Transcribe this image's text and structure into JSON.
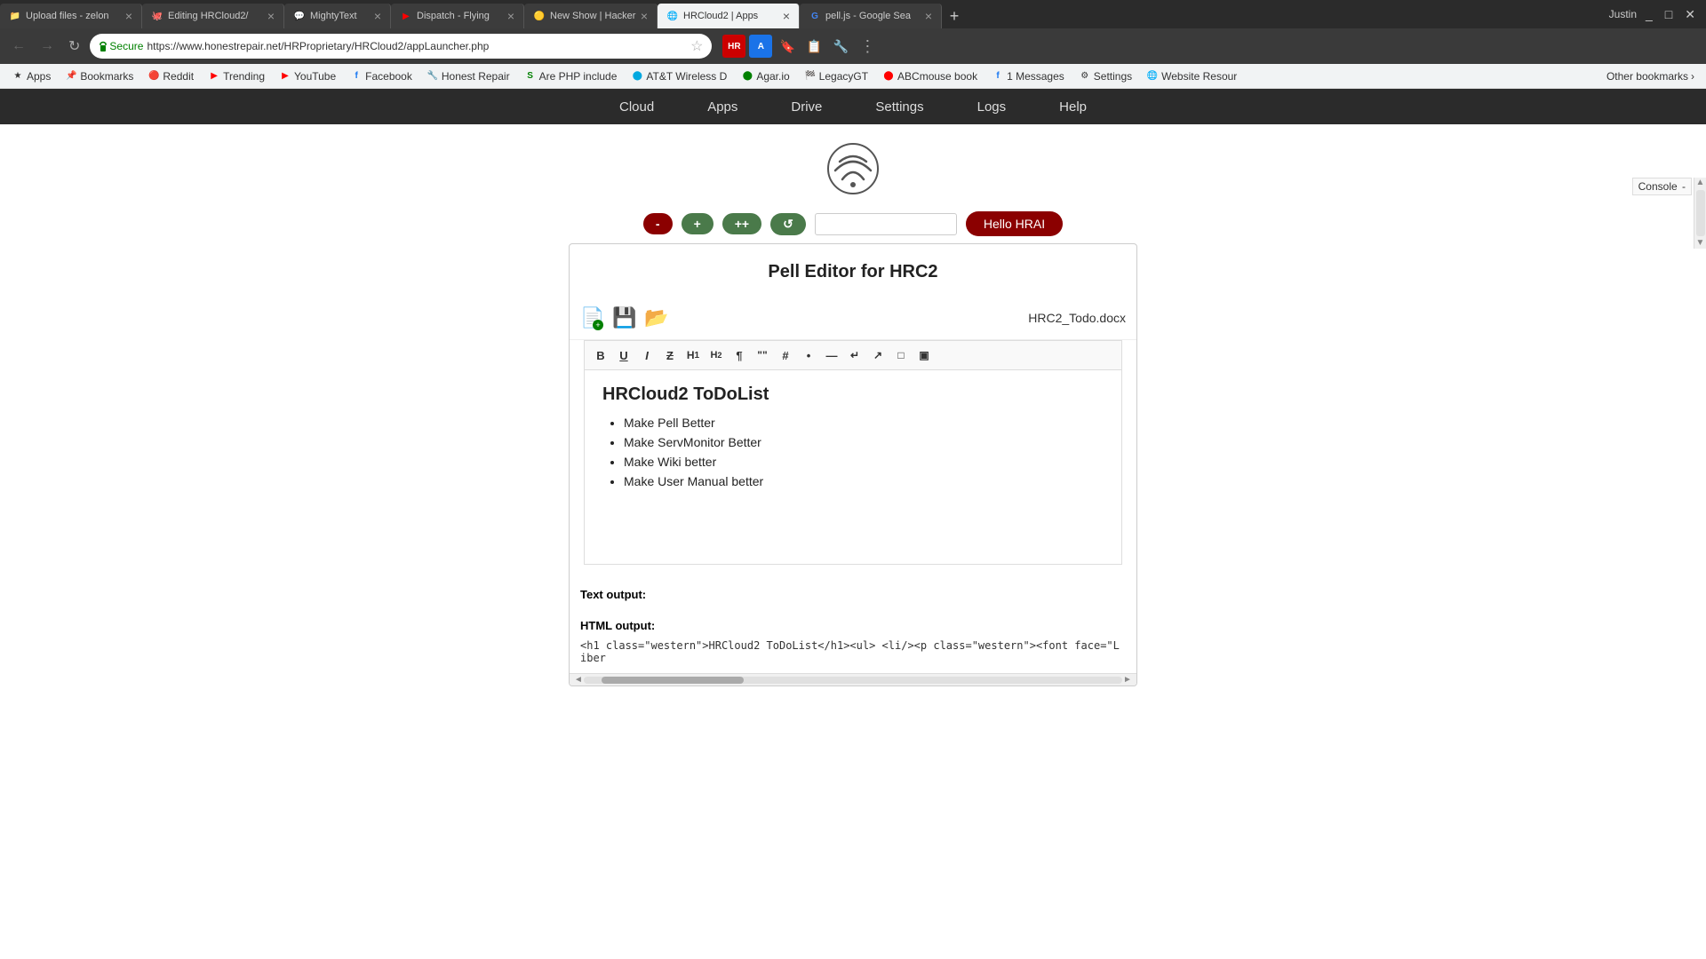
{
  "browser": {
    "user": "Justin",
    "window_buttons": [
      "_",
      "□",
      "✕"
    ],
    "tabs": [
      {
        "id": "tab-upload",
        "label": "Upload files - zelon",
        "favicon": "📁",
        "active": false,
        "closable": true
      },
      {
        "id": "tab-editing",
        "label": "Editing HRCloud2/",
        "favicon": "🐙",
        "active": false,
        "closable": true
      },
      {
        "id": "tab-mightytext",
        "label": "MightyText",
        "favicon": "💬",
        "active": false,
        "closable": true
      },
      {
        "id": "tab-dispatch",
        "label": "Dispatch - Flying",
        "favicon": "▶",
        "active": false,
        "closable": true
      },
      {
        "id": "tab-newshow",
        "label": "New Show | Hacker",
        "favicon": "🟡",
        "active": false,
        "closable": true
      },
      {
        "id": "tab-hrcloud",
        "label": "HRCloud2 | Apps",
        "favicon": "🌐",
        "active": true,
        "closable": true
      },
      {
        "id": "tab-pelljs",
        "label": "pell.js - Google Sea",
        "favicon": "G",
        "active": false,
        "closable": true
      }
    ],
    "address_bar": {
      "secure_label": "Secure",
      "url": "https://www.honestrepair.net/HRProprietary/HRCloud2/appLauncher.php"
    },
    "bookmarks": [
      {
        "label": "Apps",
        "favicon": "★"
      },
      {
        "label": "Bookmarks",
        "favicon": "📌"
      },
      {
        "label": "Reddit",
        "favicon": "🔴"
      },
      {
        "label": "Trending",
        "favicon": "📈"
      },
      {
        "label": "YouTube",
        "favicon": "▶"
      },
      {
        "label": "Facebook",
        "favicon": "f"
      },
      {
        "label": "Honest Repair",
        "favicon": "🔧"
      },
      {
        "label": "Are PHP include",
        "favicon": "S"
      },
      {
        "label": "AT&T Wireless D",
        "favicon": "🔵"
      },
      {
        "label": "Agar.io",
        "favicon": "🟢"
      },
      {
        "label": "LegacyGT",
        "favicon": "🏁"
      },
      {
        "label": "ABCmouse book",
        "favicon": "🔴"
      },
      {
        "label": "1 Messages",
        "favicon": "f"
      },
      {
        "label": "Settings",
        "favicon": "⚙"
      },
      {
        "label": "Website Resour",
        "favicon": "🌐"
      },
      {
        "label": "Other bookmarks",
        "favicon": "▶"
      }
    ]
  },
  "site": {
    "nav_items": [
      "Cloud",
      "Apps",
      "Drive",
      "Settings",
      "Logs",
      "Help"
    ],
    "logo_alt": "HRCloud2 Logo"
  },
  "controls": {
    "btn_minus": "-",
    "btn_plus": "+",
    "btn_double_plus": "++",
    "btn_refresh": "↺",
    "input_placeholder": "",
    "hello_btn": "Hello HRAI"
  },
  "console": {
    "label": "Console"
  },
  "editor_page": {
    "title": "Pell Editor for HRC2",
    "filename": "HRC2_Todo.docx",
    "toolbar_buttons": [
      {
        "label": "B",
        "title": "Bold"
      },
      {
        "label": "U",
        "title": "Underline"
      },
      {
        "label": "I",
        "title": "Italic"
      },
      {
        "label": "Z",
        "title": "Strikethrough"
      },
      {
        "label": "H1",
        "title": "Heading 1"
      },
      {
        "label": "H2",
        "title": "Heading 2"
      },
      {
        "label": "¶",
        "title": "Paragraph"
      },
      {
        "label": "\"",
        "title": "Quote"
      },
      {
        "label": "#",
        "title": "Ordered List"
      },
      {
        "label": "•",
        "title": "Unordered List"
      },
      {
        "label": "—",
        "title": "Horizontal Rule"
      },
      {
        "label": "↵",
        "title": "Line Break"
      },
      {
        "label": "↗",
        "title": "Link"
      },
      {
        "label": "□",
        "title": "Image"
      },
      {
        "label": "▣",
        "title": "Table"
      }
    ],
    "doc_title": "HRCloud2 ToDoList",
    "todo_items": [
      "Make Pell Better",
      "Make ServMonitor Better",
      "Make Wiki better",
      "Make User Manual better"
    ],
    "text_output_label": "Text output:",
    "html_output_label": "HTML output:",
    "html_output_value": "<h1 class=\"western\">HRCloud2 ToDoList</h1><ul> <li/><p class=\"western\"><font face=\"Liber"
  }
}
